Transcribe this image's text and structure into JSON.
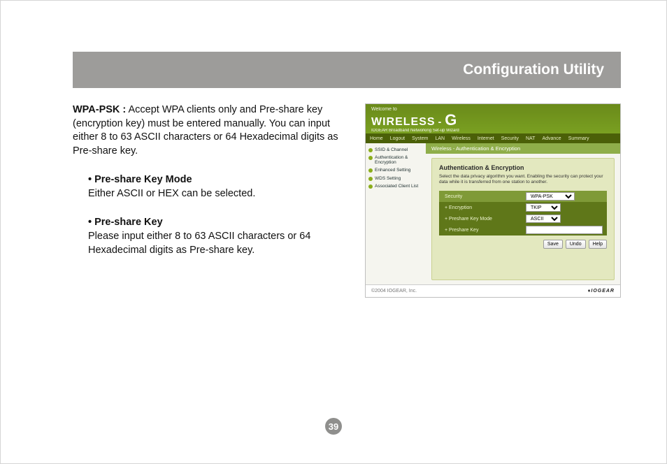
{
  "header": {
    "title": "Configuration Utility"
  },
  "body": {
    "wpa_label": "WPA-PSK :",
    "wpa_text": " Accept WPA clients only and Pre-share key (encryption key) must be entered manually. You can input either 8 to 63 ASCII characters or 64 Hexadecimal digits as Pre-share key.",
    "mode_h": "• Pre-share Key Mode",
    "mode_t": "Either ASCII or HEX can be selected.",
    "key_h": "• Pre-share Key",
    "key_t": "Please input either 8 to 63 ASCII characters or 64 Hexadecimal digits as Pre-share key."
  },
  "router": {
    "welcome": "Welcome to",
    "title_a": "WIRELESS",
    "title_dash": "-",
    "title_g": "G",
    "subtitle": "IOGEAR Broadband Networking Set-up Wizard",
    "nav": [
      "Home",
      "Logout",
      "System",
      "LAN",
      "Wireless",
      "Internet",
      "Security",
      "NAT",
      "Advance",
      "Summary"
    ],
    "side": [
      "SSID & Channel",
      "Authentication & Encryption",
      "Enhanced Setting",
      "WDS Setting",
      "Associated Client List"
    ],
    "crumb": "Wireless - Authentication & Encryption",
    "panel_title": "Authentication & Encryption",
    "panel_desc": "Select the data privacy algorithm you want. Enabling the security can protect your data while it is transferred from one station to another.",
    "rows": {
      "security_label": "Security",
      "security_value": "WPA-PSK",
      "encryption_label": "+ Encryption",
      "encryption_value": "TKIP",
      "mode_label": "+ Preshare Key Mode",
      "mode_value": "ASCII",
      "key_label": "+ Preshare Key",
      "key_value": ""
    },
    "buttons": {
      "save": "Save",
      "undo": "Undo",
      "help": "Help"
    },
    "footer_left": "©2004 IOGEAR, Inc.",
    "footer_brand": "IOGEAR"
  },
  "page_number": "39"
}
